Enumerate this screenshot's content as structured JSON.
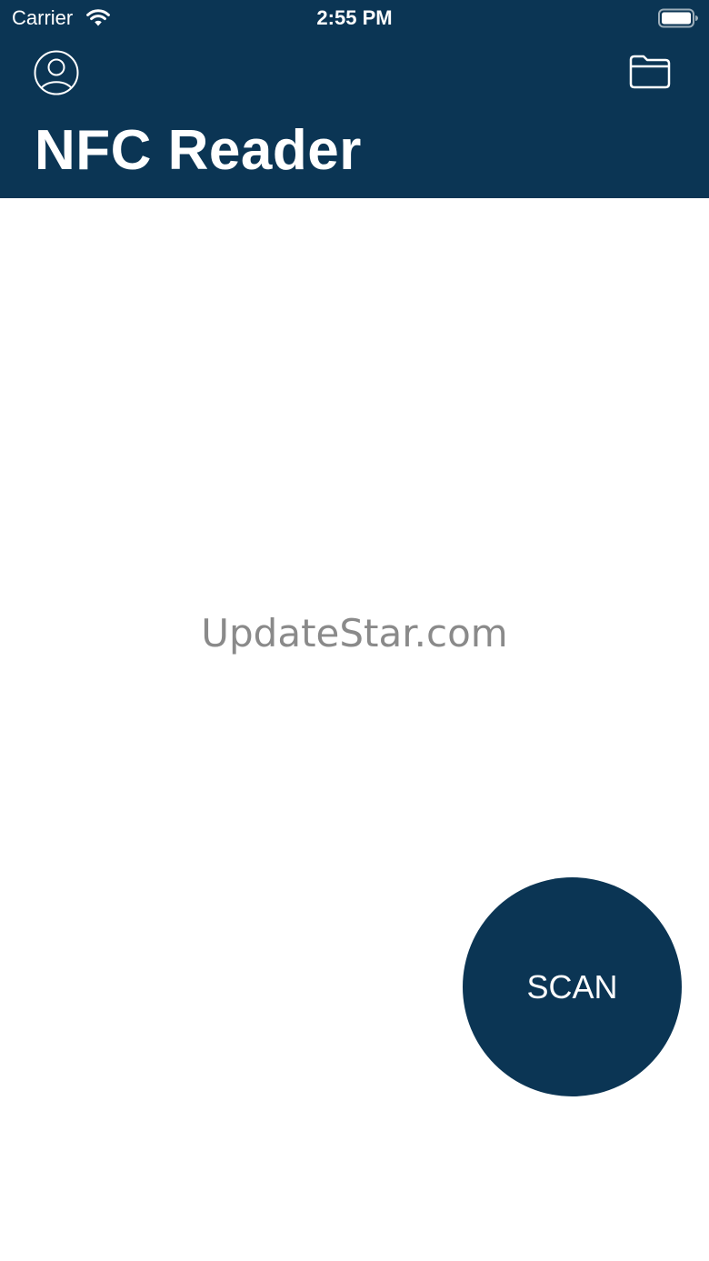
{
  "status_bar": {
    "carrier": "Carrier",
    "time": "2:55 PM",
    "wifi_icon": "wifi-icon",
    "battery_icon": "battery-icon"
  },
  "nav": {
    "profile_icon": "person-circle-icon",
    "folder_icon": "folder-icon",
    "title": "NFC Reader"
  },
  "main": {
    "watermark": "UpdateStar.com",
    "scan_label": "SCAN"
  },
  "colors": {
    "primary": "#0b3554",
    "background": "#ffffff",
    "watermark": "#8a8a8a"
  }
}
